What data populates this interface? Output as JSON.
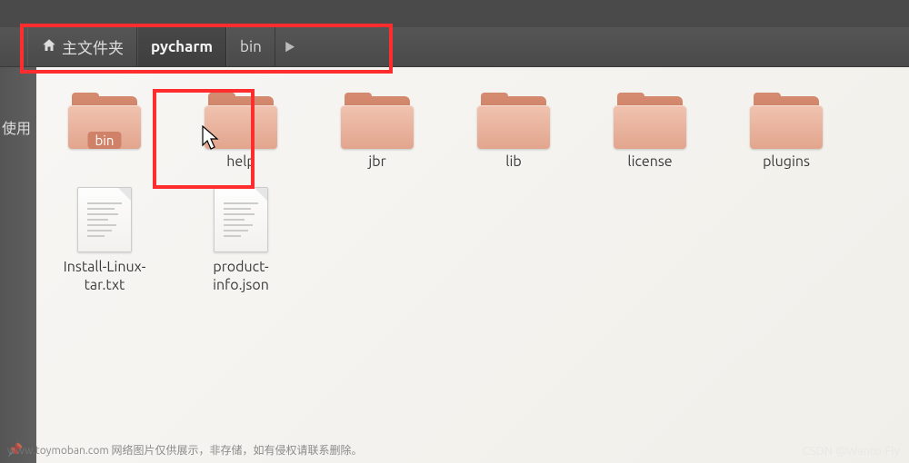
{
  "breadcrumb": {
    "home_label": "主文件夹",
    "path": [
      "pycharm",
      "bin"
    ]
  },
  "sidebar": {
    "item1": "使用"
  },
  "items": [
    {
      "type": "folder",
      "label": "bin",
      "selected": true
    },
    {
      "type": "folder",
      "label": "help"
    },
    {
      "type": "folder",
      "label": "jbr"
    },
    {
      "type": "folder",
      "label": "lib"
    },
    {
      "type": "folder",
      "label": "license"
    },
    {
      "type": "folder",
      "label": "plugins"
    },
    {
      "type": "file",
      "label": "Install-Linux-tar.txt"
    },
    {
      "type": "file",
      "label": "product-info.json"
    }
  ],
  "watermark": {
    "left": "www.toymoban.com 网络图片仅供展示，非存储，如有侵权请联系删除。",
    "right": "CSDN @Wanto-Fly"
  }
}
